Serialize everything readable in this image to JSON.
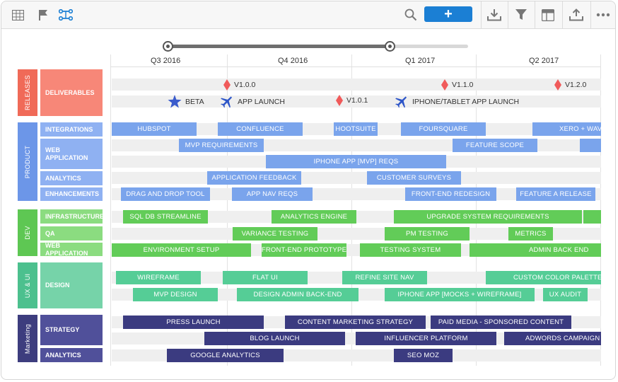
{
  "toolbar": {
    "left_icons": [
      "table-icon",
      "flag-icon",
      "roadmap-icon"
    ],
    "add_label": "+",
    "right_icons": [
      "search-icon",
      "download-icon",
      "filter-icon",
      "layout-icon",
      "upload-icon",
      "more-icon"
    ]
  },
  "timeline": {
    "quarters": [
      "Q3 2016",
      "Q4 2016",
      "Q1 2017",
      "Q2 2017"
    ],
    "slider": {
      "start_fraction": 0.0,
      "end_fraction": 0.74
    }
  },
  "colors": {
    "releases": "#f06a58",
    "releases_sub": "#f78778",
    "product": "#6c96e8",
    "product_sub": "#8fb1f2",
    "product_bar": "#7aa4ec",
    "dev": "#5ec753",
    "dev_sub": "#8bdc80",
    "dev_bar": "#62cc58",
    "ux": "#4cc08e",
    "ux_sub": "#76d3a9",
    "ux_bar": "#55cd96",
    "marketing": "#3d3d7e",
    "marketing_sub": "#50509a",
    "marketing_bar": "#3b3b80",
    "milestone_diamond": "#f05a5a",
    "milestone_star": "#3b5ccc",
    "milestone_plane": "#2d55c8"
  },
  "groups": [
    {
      "label": "RELEASES",
      "subs": [
        "DELIVERABLES"
      ]
    },
    {
      "label": "PRODUCT",
      "subs": [
        "INTEGRATIONS",
        "WEB APPLICATION",
        "ANALYTICS",
        "ENHANCEMENTS"
      ]
    },
    {
      "label": "DEV",
      "subs": [
        "INFRASTRUCTURE",
        "QA",
        "WEB APPLICATION"
      ]
    },
    {
      "label": "UX & UI",
      "subs": [
        "DESIGN"
      ]
    },
    {
      "label": "Marketing",
      "subs": [
        "STRATEGY",
        "ANALYTICS"
      ]
    }
  ],
  "milestones": [
    {
      "label": "V1.0.0",
      "icon": "diamond"
    },
    {
      "label": "V1.1.0",
      "icon": "diamond"
    },
    {
      "label": "V1.2.0",
      "icon": "diamond"
    },
    {
      "label": "BETA",
      "icon": "star"
    },
    {
      "label": "APP LAUNCH",
      "icon": "plane"
    },
    {
      "label": "V1.0.1",
      "icon": "diamond"
    },
    {
      "label": "IPHONE/TABLET APP LAUNCH",
      "icon": "plane"
    }
  ],
  "bars": {
    "integrations": [
      "HUBSPOT",
      "CONFLUENCE",
      "HOOTSUITE",
      "FOURSQUARE",
      "XERO + WAVE"
    ],
    "web_application_1": [
      "MVP REQUIREMENTS",
      "FEATURE SCOPE",
      ""
    ],
    "web_application_2": [
      "IPHONE APP [MVP] REQS"
    ],
    "analytics": [
      "APPLICATION FEEDBACK",
      "CUSTOMER SURVEYS"
    ],
    "enhancements": [
      "DRAG AND DROP TOOL",
      "APP NAV REQS",
      "FRONT-END REDESIGN",
      "FEATURE A RELEASE"
    ],
    "infrastructure": [
      "SQL DB STREAMLINE",
      "ANALYTICS ENGINE",
      "UPGRADE SYSTEM REQUIREMENTS",
      ""
    ],
    "qa": [
      "VARIANCE TESTING",
      "PM TESTING",
      "METRICS"
    ],
    "dev_web_application": [
      "ENVIRONMENT SETUP",
      "FRONT-END PROTOTYPE",
      "TESTING SYSTEM",
      "ADMIN BACK END"
    ],
    "design_1": [
      "WIREFRAME",
      "FLAT UI",
      "REFINE SITE NAV",
      "CUSTOM COLOR PALETTES"
    ],
    "design_2": [
      "MVP DESIGN",
      "DESIGN ADMIN BACK-END",
      "IPHONE APP [MOCKS + WIREFRAME]",
      "UX AUDIT"
    ],
    "strategy_1": [
      "PRESS LAUNCH",
      "CONTENT MARKETING STRATEGY",
      "PAID MEDIA - SPONSORED CONTENT"
    ],
    "strategy_2": [
      "BLOG LAUNCH",
      "INFLUENCER PLATFORM",
      "ADWORDS CAMPAIGN"
    ],
    "mkt_analytics": [
      "GOOGLE ANALYTICS",
      "SEO MOZ"
    ]
  }
}
